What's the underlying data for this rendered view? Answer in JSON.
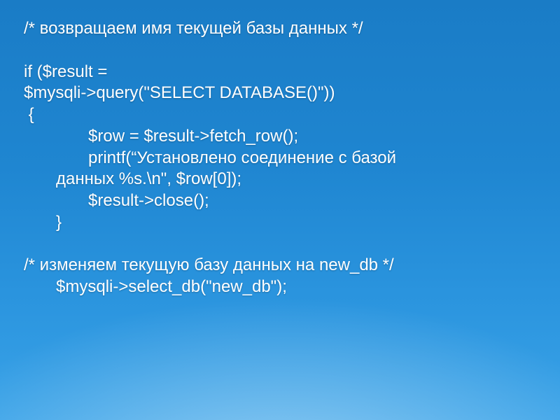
{
  "lines": {
    "l0": "/* возвращаем имя текущей базы данных */",
    "l1": "if ($result =",
    "l2": "$mysqli->query(\"SELECT DATABASE()\"))",
    "l3": " {",
    "l4": "$row = $result->fetch_row();",
    "l5": "printf(“Установлено соединение с базой",
    "l6": "данных %s.\\n\", $row[0]);",
    "l7": "$result->close();",
    "l8": "}",
    "l9": "/* изменяем текущую базу данных на new_db */",
    "l10": "$mysqli->select_db(\"new_db\");"
  }
}
